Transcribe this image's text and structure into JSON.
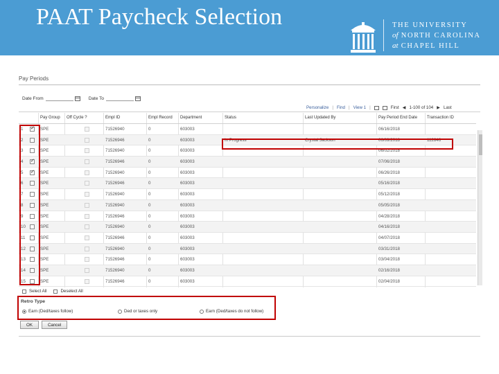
{
  "slide": {
    "title": "PAAT Paycheck Selection",
    "logo": {
      "line1": "THE UNIVERSITY",
      "line2_prefix": "of",
      "line2": "NORTH CAROLINA",
      "line3_prefix": "at",
      "line3": "CHAPEL HILL"
    }
  },
  "colors": {
    "banner": "#4b9cd3",
    "highlight": "#c00000"
  },
  "page": {
    "title": "Pay Periods",
    "date_from_label": "Date From",
    "date_to_label": "Date To",
    "date_from_value": "",
    "date_to_value": ""
  },
  "toolbar": {
    "personalize": "Personalize",
    "find": "Find",
    "view": "View 1",
    "first": "First",
    "range": "1-100 of 104",
    "last": "Last"
  },
  "grid": {
    "columns": [
      "Pay Group",
      "Off Cycle ?",
      "Empl ID",
      "Empl Record",
      "Department",
      "Status",
      "Last Updated By",
      "Pay Period End Date",
      "Transaction ID"
    ],
    "rows": [
      {
        "n": "1",
        "sel": true,
        "pg": "SPE",
        "emplid": "71526940",
        "rec": "0",
        "dept": "603003",
        "status": "",
        "updby": "",
        "end": "06/16/2018",
        "trans": ""
      },
      {
        "n": "2",
        "sel": false,
        "pg": "SPE",
        "emplid": "71526946",
        "rec": "0",
        "dept": "603003",
        "status": "In Progress",
        "updby": "Crystal Jackson",
        "end": "06/09/2018",
        "trans": "112846"
      },
      {
        "n": "3",
        "sel": false,
        "pg": "SPE",
        "emplid": "71526940",
        "rec": "0",
        "dept": "603003",
        "status": "",
        "updby": "",
        "end": "06/02/2018",
        "trans": ""
      },
      {
        "n": "4",
        "sel": true,
        "pg": "SPE",
        "emplid": "71526946",
        "rec": "0",
        "dept": "603003",
        "status": "",
        "updby": "",
        "end": "07/06/2018",
        "trans": ""
      },
      {
        "n": "5",
        "sel": true,
        "pg": "SPE",
        "emplid": "71526940",
        "rec": "0",
        "dept": "603003",
        "status": "",
        "updby": "",
        "end": "06/26/2018",
        "trans": ""
      },
      {
        "n": "6",
        "sel": false,
        "pg": "SPE",
        "emplid": "71526946",
        "rec": "0",
        "dept": "603003",
        "status": "",
        "updby": "",
        "end": "05/16/2018",
        "trans": ""
      },
      {
        "n": "7",
        "sel": false,
        "pg": "SPE",
        "emplid": "71526940",
        "rec": "0",
        "dept": "603003",
        "status": "",
        "updby": "",
        "end": "05/12/2018",
        "trans": ""
      },
      {
        "n": "8",
        "sel": false,
        "pg": "SPE",
        "emplid": "71526940",
        "rec": "0",
        "dept": "603003",
        "status": "",
        "updby": "",
        "end": "05/05/2018",
        "trans": ""
      },
      {
        "n": "9",
        "sel": false,
        "pg": "SPE",
        "emplid": "71526946",
        "rec": "0",
        "dept": "603003",
        "status": "",
        "updby": "",
        "end": "04/28/2018",
        "trans": ""
      },
      {
        "n": "10",
        "sel": false,
        "pg": "SPE",
        "emplid": "71526940",
        "rec": "0",
        "dept": "603003",
        "status": "",
        "updby": "",
        "end": "04/16/2018",
        "trans": ""
      },
      {
        "n": "11",
        "sel": false,
        "pg": "SPE",
        "emplid": "71526946",
        "rec": "0",
        "dept": "603003",
        "status": "",
        "updby": "",
        "end": "04/07/2018",
        "trans": ""
      },
      {
        "n": "12",
        "sel": false,
        "pg": "SPE",
        "emplid": "71526940",
        "rec": "0",
        "dept": "603003",
        "status": "",
        "updby": "",
        "end": "03/31/2018",
        "trans": ""
      },
      {
        "n": "13",
        "sel": false,
        "pg": "SPE",
        "emplid": "71526946",
        "rec": "0",
        "dept": "603003",
        "status": "",
        "updby": "",
        "end": "03/04/2018",
        "trans": ""
      },
      {
        "n": "14",
        "sel": false,
        "pg": "SPE",
        "emplid": "71526940",
        "rec": "0",
        "dept": "603003",
        "status": "",
        "updby": "",
        "end": "02/16/2018",
        "trans": ""
      },
      {
        "n": "15",
        "sel": false,
        "pg": "SPE",
        "emplid": "71526946",
        "rec": "0",
        "dept": "603003",
        "status": "",
        "updby": "",
        "end": "02/04/2018",
        "trans": ""
      }
    ]
  },
  "select": {
    "select_all": "Select All",
    "deselect_all": "Deselect All"
  },
  "retro": {
    "title": "Retro Type",
    "options": [
      {
        "label": "Earn (Ded/taxes follow)",
        "selected": true
      },
      {
        "label": "Ded or taxes only",
        "selected": false
      },
      {
        "label": "Earn (Ded/taxes do not follow)",
        "selected": false
      }
    ]
  },
  "buttons": {
    "ok": "OK",
    "cancel": "Cancel"
  }
}
